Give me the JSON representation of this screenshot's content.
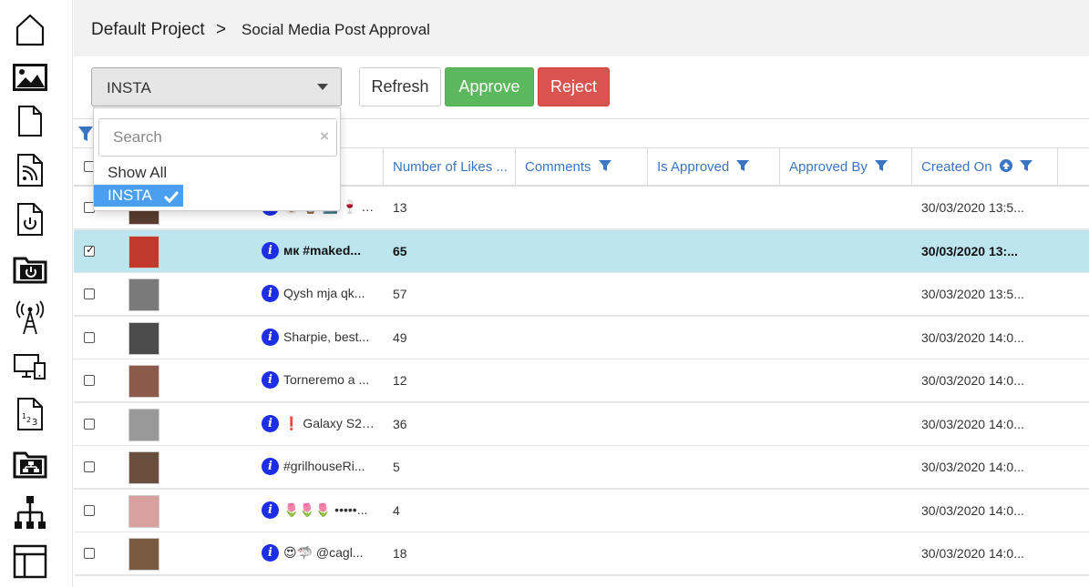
{
  "sidebar": {
    "items": [
      {
        "name": "home-icon"
      },
      {
        "name": "image-icon",
        "active": true
      },
      {
        "name": "document-icon"
      },
      {
        "name": "rss-file-icon"
      },
      {
        "name": "power-file-icon"
      },
      {
        "name": "power-folder-icon"
      },
      {
        "name": "antenna-icon"
      },
      {
        "name": "devices-icon"
      },
      {
        "name": "numbers-file-icon"
      },
      {
        "name": "network-folder-icon"
      },
      {
        "name": "hierarchy-icon"
      },
      {
        "name": "layout-icon"
      }
    ]
  },
  "header": {
    "breadcrumb_project": "Default Project",
    "breadcrumb_separator": ">",
    "page_title": "Social Media Post Approval"
  },
  "toolbar": {
    "source_select_value": "INSTA",
    "refresh_label": "Refresh",
    "approve_label": "Approve",
    "reject_label": "Reject"
  },
  "dropdown": {
    "search_placeholder": "Search",
    "clear_icon": "×",
    "options": [
      "Show All",
      "INSTA"
    ],
    "selected": "INSTA"
  },
  "grid": {
    "columns": {
      "likes": "Number of Likes ...",
      "comments": "Comments",
      "is_approved": "Is Approved",
      "approved_by": "Approved By",
      "created_on": "Created On"
    },
    "rows": [
      {
        "checked": false,
        "text": "🥃 ⌚ 🔟 🍷 Pr...",
        "likes": "13",
        "created": "30/03/2020 13:5...",
        "thumb": "#5a3d2e"
      },
      {
        "checked": true,
        "text": "мк #maked...",
        "likes": "65",
        "created": "30/03/2020 13:...",
        "thumb": "#c0392b"
      },
      {
        "checked": false,
        "text": "Qysh mja qk...",
        "likes": "57",
        "created": "30/03/2020 13:5...",
        "thumb": "#7a7a7a"
      },
      {
        "checked": false,
        "text": "Sharpie, best...",
        "likes": "49",
        "created": "30/03/2020 14:0...",
        "thumb": "#4b4b4b"
      },
      {
        "checked": false,
        "text": "Torneremo a ...",
        "likes": "12",
        "created": "30/03/2020 14:0...",
        "thumb": "#8c5a4a"
      },
      {
        "checked": false,
        "text": "❗ Galaxy S20 ...",
        "likes": "36",
        "created": "30/03/2020 14:0...",
        "thumb": "#999999"
      },
      {
        "checked": false,
        "text": "#grilhouseRi...",
        "likes": "5",
        "created": "30/03/2020 14:0...",
        "thumb": "#6b4e3d"
      },
      {
        "checked": false,
        "text": "🌷🌷🌷 •••••...",
        "likes": "4",
        "created": "30/03/2020 14:0...",
        "thumb": "#d9a0a0"
      },
      {
        "checked": false,
        "text": "😍🦈 @cagl...",
        "likes": "18",
        "created": "30/03/2020 14:0...",
        "thumb": "#7a5a40"
      }
    ]
  },
  "colors": {
    "accent_blue": "#3a75c4",
    "approve_green": "#5cb85c",
    "reject_red": "#d9534f",
    "selected_row": "#bde5f0",
    "dropdown_highlight": "#4a9ff0",
    "info_icon": "#1c2ee6"
  }
}
